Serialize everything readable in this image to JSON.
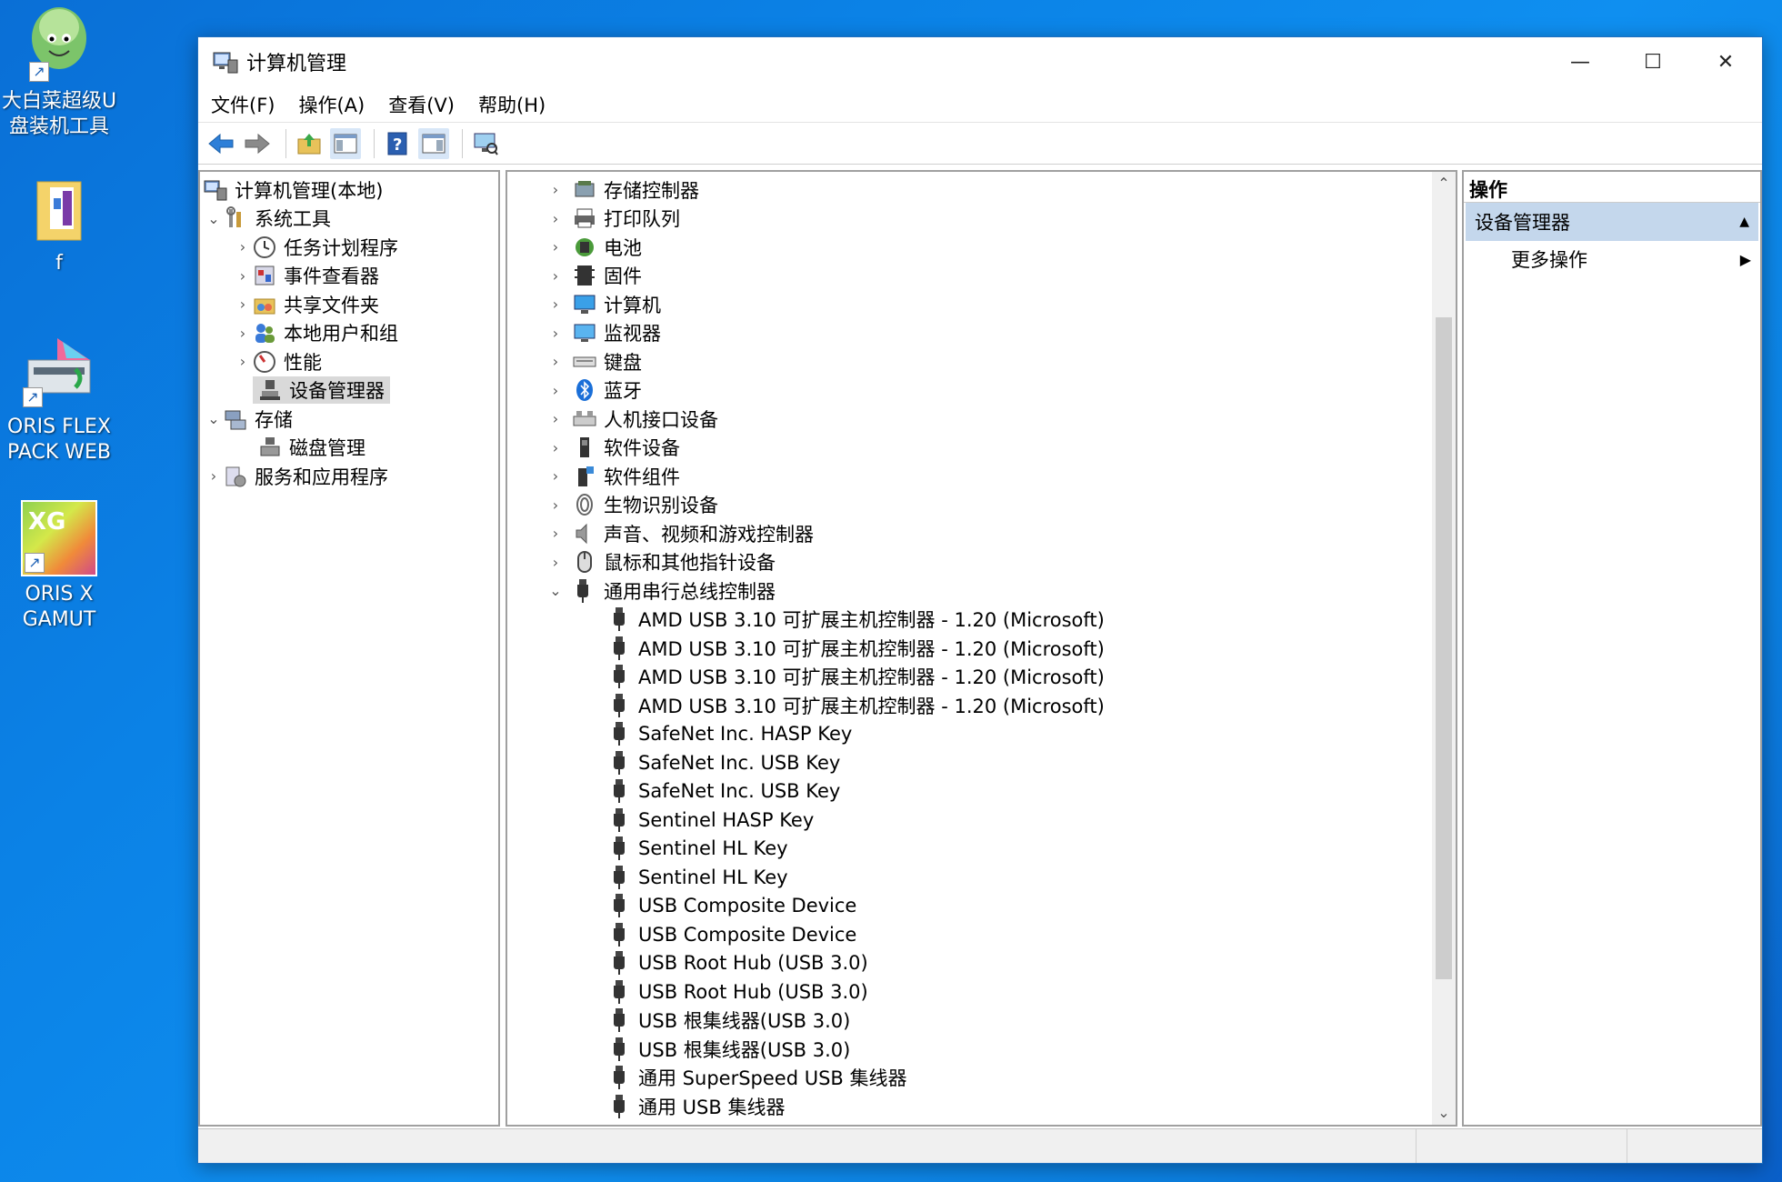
{
  "desktop": {
    "icons": [
      {
        "label_line1": "大白菜超级U",
        "label_line2": "盘装机工具"
      },
      {
        "label_line1": "f",
        "label_line2": ""
      },
      {
        "label_line1": "ORIS FLEX",
        "label_line2": "PACK WEB"
      },
      {
        "label_line1": "ORIS X",
        "label_line2": "GAMUT"
      }
    ],
    "xg_text": "XG"
  },
  "window": {
    "title": "计算机管理",
    "minimize": "—",
    "maximize": "☐",
    "close": "✕"
  },
  "menubar": {
    "file": "文件(F)",
    "action": "操作(A)",
    "view": "查看(V)",
    "help": "帮助(H)"
  },
  "left_tree": {
    "root": "计算机管理(本地)",
    "system_tools": "系统工具",
    "task_scheduler": "任务计划程序",
    "event_viewer": "事件查看器",
    "shared_folders": "共享文件夹",
    "local_users": "本地用户和组",
    "performance": "性能",
    "device_manager": "设备管理器",
    "storage": "存储",
    "disk_management": "磁盘管理",
    "services_apps": "服务和应用程序"
  },
  "device_categories": [
    {
      "label": "存储控制器",
      "icon": "storage-controller-icon"
    },
    {
      "label": "打印队列",
      "icon": "printer-icon"
    },
    {
      "label": "电池",
      "icon": "battery-icon"
    },
    {
      "label": "固件",
      "icon": "firmware-icon"
    },
    {
      "label": "计算机",
      "icon": "computer-icon"
    },
    {
      "label": "监视器",
      "icon": "monitor-icon"
    },
    {
      "label": "键盘",
      "icon": "keyboard-icon"
    },
    {
      "label": "蓝牙",
      "icon": "bluetooth-icon"
    },
    {
      "label": "人机接口设备",
      "icon": "hid-icon"
    },
    {
      "label": "软件设备",
      "icon": "software-device-icon"
    },
    {
      "label": "软件组件",
      "icon": "software-component-icon"
    },
    {
      "label": "生物识别设备",
      "icon": "fingerprint-icon"
    },
    {
      "label": "声音、视频和游戏控制器",
      "icon": "speaker-icon"
    },
    {
      "label": "鼠标和其他指针设备",
      "icon": "mouse-icon"
    }
  ],
  "usb_category": "通用串行总线控制器",
  "usb_devices": [
    "AMD USB 3.10 可扩展主机控制器 - 1.20 (Microsoft)",
    "AMD USB 3.10 可扩展主机控制器 - 1.20 (Microsoft)",
    "AMD USB 3.10 可扩展主机控制器 - 1.20 (Microsoft)",
    "AMD USB 3.10 可扩展主机控制器 - 1.20 (Microsoft)",
    "SafeNet Inc. HASP Key",
    "SafeNet Inc. USB Key",
    "SafeNet Inc. USB Key",
    "Sentinel HASP Key",
    "Sentinel HL Key",
    "Sentinel HL Key",
    "USB Composite Device",
    "USB Composite Device",
    "USB Root Hub (USB 3.0)",
    "USB Root Hub (USB 3.0)",
    "USB 根集线器(USB 3.0)",
    "USB 根集线器(USB 3.0)",
    "通用 SuperSpeed USB 集线器",
    "通用 USB 集线器"
  ],
  "actions": {
    "header": "操作",
    "section": "设备管理器",
    "more": "更多操作"
  },
  "colors": {
    "desktop_bg": "#0b82e6",
    "selected_row": "#d9d9d9",
    "actions_section_bg": "#c4d7ec"
  }
}
